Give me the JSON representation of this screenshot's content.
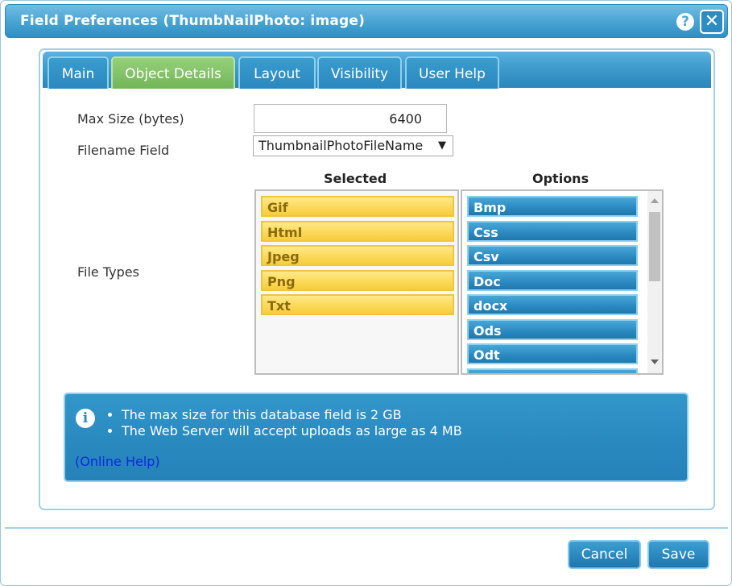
{
  "window": {
    "title": "Field Preferences (ThumbNailPhoto: image)",
    "help_glyph": "?",
    "close_glyph": "✕"
  },
  "tabs": [
    {
      "label": "Main",
      "active": false
    },
    {
      "label": "Object Details",
      "active": true
    },
    {
      "label": "Layout",
      "active": false
    },
    {
      "label": "Visibility",
      "active": false
    },
    {
      "label": "User Help",
      "active": false
    }
  ],
  "form": {
    "max_size_label": "Max Size (bytes)",
    "max_size_value": "6400",
    "filename_label": "Filename Field",
    "filename_value": "ThumbnailPhotoFileName",
    "dropdown_arrow": "▼",
    "file_types_label": "File Types",
    "selected_header": "Selected",
    "options_header": "Options",
    "selected_types": [
      "Gif",
      "Html",
      "Jpeg",
      "Png",
      "Txt"
    ],
    "option_types": [
      "Bmp",
      "Css",
      "Csv",
      "Doc",
      "docx",
      "Ods",
      "Odt"
    ]
  },
  "info": {
    "icon_glyph": "i",
    "bullets": [
      "The max size for this database field is 2 GB",
      "The Web Server will accept uploads as large as 4 MB"
    ],
    "online_help": "(Online Help)"
  },
  "buttons": {
    "cancel": "Cancel",
    "save": "Save"
  },
  "colors": {
    "accent_blue": "#2a88be",
    "active_tab_green": "#73b558",
    "selected_chip_yellow": "#fbd95a",
    "link_blue": "#0a2bdc"
  }
}
